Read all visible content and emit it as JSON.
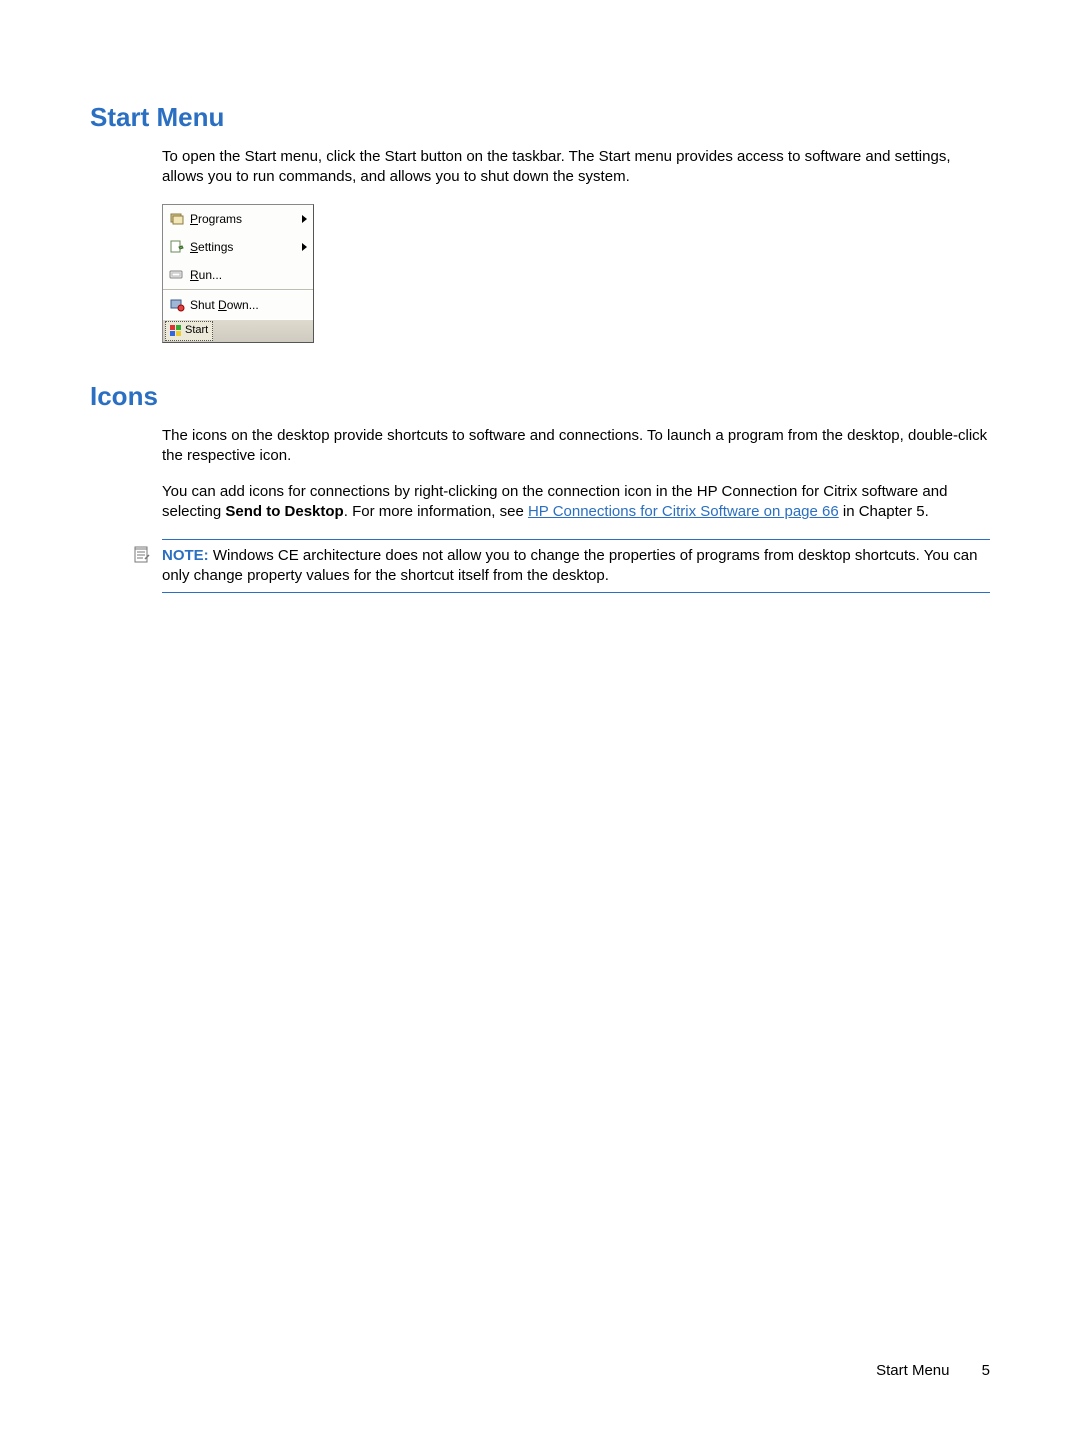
{
  "sections": {
    "start_menu": {
      "heading": "Start Menu",
      "intro": "To open the Start menu, click the Start button on the taskbar. The Start menu provides access to software and settings, allows you to run commands, and allows you to shut down the system."
    },
    "icons": {
      "heading": "Icons",
      "p1": "The icons on the desktop provide shortcuts to software and connections. To launch a program from the desktop, double-click the respective icon.",
      "p2_pre": "You can add icons for connections by right-clicking on the connection icon in the HP Connection for Citrix software and selecting ",
      "p2_bold": "Send to Desktop",
      "p2_mid": ". For more information, see ",
      "p2_link": "HP Connections for Citrix Software on page 66",
      "p2_post": " in Chapter 5.",
      "note_label": "NOTE:",
      "note_text": " Windows CE architecture does not allow you to change the properties of programs from desktop shortcuts. You can only change property values for the shortcut itself from the desktop."
    }
  },
  "start_menu_ui": {
    "items": [
      {
        "label": "Programs",
        "underline": "P",
        "arrow": true,
        "icon": "programs"
      },
      {
        "label": "Settings",
        "underline": "S",
        "arrow": true,
        "icon": "settings"
      },
      {
        "label": "Run...",
        "underline": "R",
        "arrow": false,
        "icon": "run"
      }
    ],
    "shutdown": {
      "label": "Shut Down...",
      "underline": "D",
      "icon": "shutdown"
    },
    "start_button": "Start"
  },
  "footer": {
    "title": "Start Menu",
    "page": "5"
  }
}
